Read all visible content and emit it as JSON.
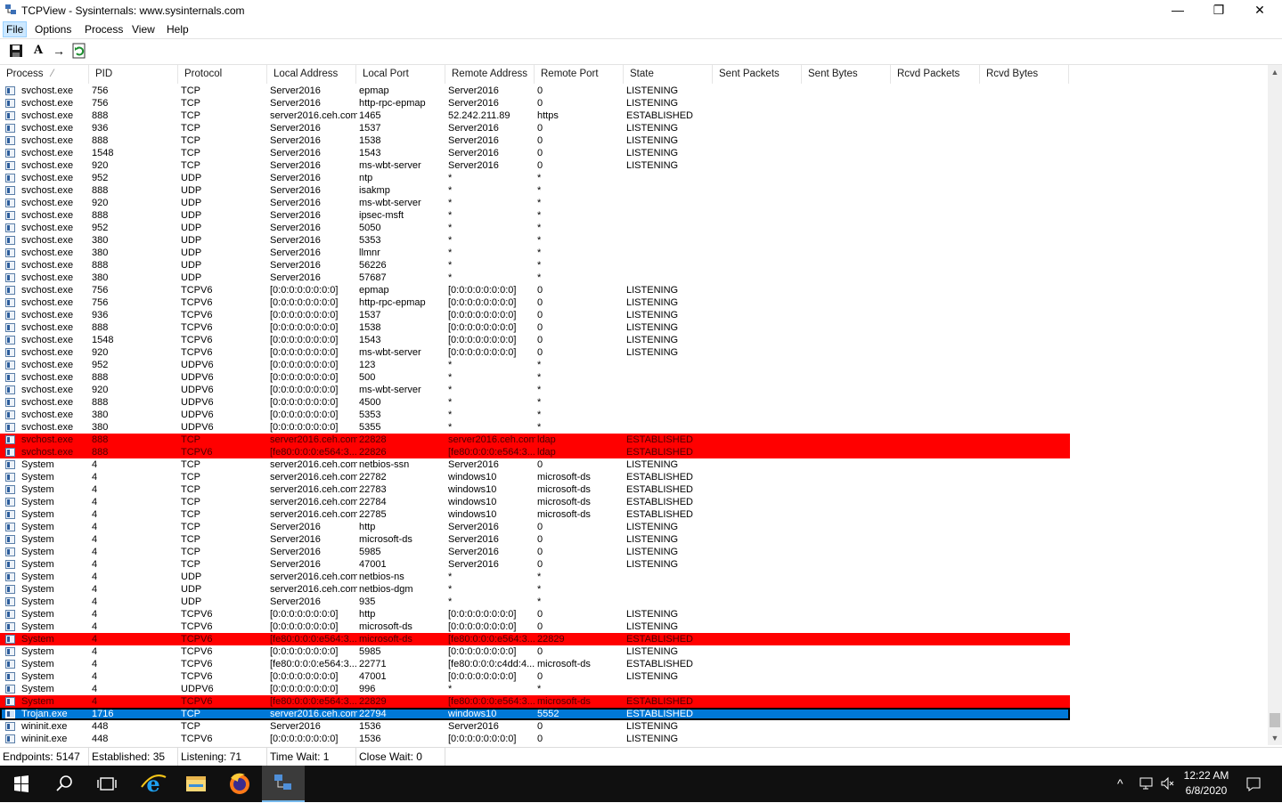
{
  "window": {
    "title": "TCPView - Sysinternals: www.sysinternals.com",
    "minimize": "—",
    "restore": "❐",
    "close": "✕"
  },
  "menu": [
    "File",
    "Options",
    "Process",
    "View",
    "Help"
  ],
  "toolbar": {
    "icons": [
      "save-icon",
      "font-icon",
      "resolve-addresses-icon",
      "refresh-icon"
    ],
    "font_glyph": "A",
    "resolve_glyph": "→"
  },
  "columns": [
    "Process",
    "PID",
    "Protocol",
    "Local Address",
    "Local Port",
    "Remote Address",
    "Remote Port",
    "State",
    "Sent Packets",
    "Sent Bytes",
    "Rcvd Packets",
    "Rcvd Bytes"
  ],
  "sort_indicator": "⁄",
  "rows": [
    [
      "svchost.exe",
      "756",
      "TCP",
      "Server2016",
      "epmap",
      "Server2016",
      "0",
      "LISTENING",
      ""
    ],
    [
      "svchost.exe",
      "756",
      "TCP",
      "Server2016",
      "http-rpc-epmap",
      "Server2016",
      "0",
      "LISTENING",
      ""
    ],
    [
      "svchost.exe",
      "888",
      "TCP",
      "server2016.ceh.com",
      "1465",
      "52.242.211.89",
      "https",
      "ESTABLISHED",
      ""
    ],
    [
      "svchost.exe",
      "936",
      "TCP",
      "Server2016",
      "1537",
      "Server2016",
      "0",
      "LISTENING",
      ""
    ],
    [
      "svchost.exe",
      "888",
      "TCP",
      "Server2016",
      "1538",
      "Server2016",
      "0",
      "LISTENING",
      ""
    ],
    [
      "svchost.exe",
      "1548",
      "TCP",
      "Server2016",
      "1543",
      "Server2016",
      "0",
      "LISTENING",
      ""
    ],
    [
      "svchost.exe",
      "920",
      "TCP",
      "Server2016",
      "ms-wbt-server",
      "Server2016",
      "0",
      "LISTENING",
      ""
    ],
    [
      "svchost.exe",
      "952",
      "UDP",
      "Server2016",
      "ntp",
      "*",
      "*",
      "",
      ""
    ],
    [
      "svchost.exe",
      "888",
      "UDP",
      "Server2016",
      "isakmp",
      "*",
      "*",
      "",
      ""
    ],
    [
      "svchost.exe",
      "920",
      "UDP",
      "Server2016",
      "ms-wbt-server",
      "*",
      "*",
      "",
      ""
    ],
    [
      "svchost.exe",
      "888",
      "UDP",
      "Server2016",
      "ipsec-msft",
      "*",
      "*",
      "",
      ""
    ],
    [
      "svchost.exe",
      "952",
      "UDP",
      "Server2016",
      "5050",
      "*",
      "*",
      "",
      ""
    ],
    [
      "svchost.exe",
      "380",
      "UDP",
      "Server2016",
      "5353",
      "*",
      "*",
      "",
      ""
    ],
    [
      "svchost.exe",
      "380",
      "UDP",
      "Server2016",
      "llmnr",
      "*",
      "*",
      "",
      ""
    ],
    [
      "svchost.exe",
      "888",
      "UDP",
      "Server2016",
      "56226",
      "*",
      "*",
      "",
      ""
    ],
    [
      "svchost.exe",
      "380",
      "UDP",
      "Server2016",
      "57687",
      "*",
      "*",
      "",
      ""
    ],
    [
      "svchost.exe",
      "756",
      "TCPV6",
      "[0:0:0:0:0:0:0:0]",
      "epmap",
      "[0:0:0:0:0:0:0:0]",
      "0",
      "LISTENING",
      ""
    ],
    [
      "svchost.exe",
      "756",
      "TCPV6",
      "[0:0:0:0:0:0:0:0]",
      "http-rpc-epmap",
      "[0:0:0:0:0:0:0:0]",
      "0",
      "LISTENING",
      ""
    ],
    [
      "svchost.exe",
      "936",
      "TCPV6",
      "[0:0:0:0:0:0:0:0]",
      "1537",
      "[0:0:0:0:0:0:0:0]",
      "0",
      "LISTENING",
      ""
    ],
    [
      "svchost.exe",
      "888",
      "TCPV6",
      "[0:0:0:0:0:0:0:0]",
      "1538",
      "[0:0:0:0:0:0:0:0]",
      "0",
      "LISTENING",
      ""
    ],
    [
      "svchost.exe",
      "1548",
      "TCPV6",
      "[0:0:0:0:0:0:0:0]",
      "1543",
      "[0:0:0:0:0:0:0:0]",
      "0",
      "LISTENING",
      ""
    ],
    [
      "svchost.exe",
      "920",
      "TCPV6",
      "[0:0:0:0:0:0:0:0]",
      "ms-wbt-server",
      "[0:0:0:0:0:0:0:0]",
      "0",
      "LISTENING",
      ""
    ],
    [
      "svchost.exe",
      "952",
      "UDPV6",
      "[0:0:0:0:0:0:0:0]",
      "123",
      "*",
      "*",
      "",
      ""
    ],
    [
      "svchost.exe",
      "888",
      "UDPV6",
      "[0:0:0:0:0:0:0:0]",
      "500",
      "*",
      "*",
      "",
      ""
    ],
    [
      "svchost.exe",
      "920",
      "UDPV6",
      "[0:0:0:0:0:0:0:0]",
      "ms-wbt-server",
      "*",
      "*",
      "",
      ""
    ],
    [
      "svchost.exe",
      "888",
      "UDPV6",
      "[0:0:0:0:0:0:0:0]",
      "4500",
      "*",
      "*",
      "",
      ""
    ],
    [
      "svchost.exe",
      "380",
      "UDPV6",
      "[0:0:0:0:0:0:0:0]",
      "5353",
      "*",
      "*",
      "",
      ""
    ],
    [
      "svchost.exe",
      "380",
      "UDPV6",
      "[0:0:0:0:0:0:0:0]",
      "5355",
      "*",
      "*",
      "",
      ""
    ],
    [
      "svchost.exe",
      "888",
      "TCP",
      "server2016.ceh.com",
      "22828",
      "server2016.ceh.com",
      "ldap",
      "ESTABLISHED",
      "red"
    ],
    [
      "svchost.exe",
      "888",
      "TCPV6",
      "[fe80:0:0:0:e564:3...",
      "22826",
      "[fe80:0:0:0:e564:3...",
      "ldap",
      "ESTABLISHED",
      "red"
    ],
    [
      "System",
      "4",
      "TCP",
      "server2016.ceh.com",
      "netbios-ssn",
      "Server2016",
      "0",
      "LISTENING",
      ""
    ],
    [
      "System",
      "4",
      "TCP",
      "server2016.ceh.com",
      "22782",
      "windows10",
      "microsoft-ds",
      "ESTABLISHED",
      ""
    ],
    [
      "System",
      "4",
      "TCP",
      "server2016.ceh.com",
      "22783",
      "windows10",
      "microsoft-ds",
      "ESTABLISHED",
      ""
    ],
    [
      "System",
      "4",
      "TCP",
      "server2016.ceh.com",
      "22784",
      "windows10",
      "microsoft-ds",
      "ESTABLISHED",
      ""
    ],
    [
      "System",
      "4",
      "TCP",
      "server2016.ceh.com",
      "22785",
      "windows10",
      "microsoft-ds",
      "ESTABLISHED",
      ""
    ],
    [
      "System",
      "4",
      "TCP",
      "Server2016",
      "http",
      "Server2016",
      "0",
      "LISTENING",
      ""
    ],
    [
      "System",
      "4",
      "TCP",
      "Server2016",
      "microsoft-ds",
      "Server2016",
      "0",
      "LISTENING",
      ""
    ],
    [
      "System",
      "4",
      "TCP",
      "Server2016",
      "5985",
      "Server2016",
      "0",
      "LISTENING",
      ""
    ],
    [
      "System",
      "4",
      "TCP",
      "Server2016",
      "47001",
      "Server2016",
      "0",
      "LISTENING",
      ""
    ],
    [
      "System",
      "4",
      "UDP",
      "server2016.ceh.com",
      "netbios-ns",
      "*",
      "*",
      "",
      ""
    ],
    [
      "System",
      "4",
      "UDP",
      "server2016.ceh.com",
      "netbios-dgm",
      "*",
      "*",
      "",
      ""
    ],
    [
      "System",
      "4",
      "UDP",
      "Server2016",
      "935",
      "*",
      "*",
      "",
      ""
    ],
    [
      "System",
      "4",
      "TCPV6",
      "[0:0:0:0:0:0:0:0]",
      "http",
      "[0:0:0:0:0:0:0:0]",
      "0",
      "LISTENING",
      ""
    ],
    [
      "System",
      "4",
      "TCPV6",
      "[0:0:0:0:0:0:0:0]",
      "microsoft-ds",
      "[0:0:0:0:0:0:0:0]",
      "0",
      "LISTENING",
      ""
    ],
    [
      "System",
      "4",
      "TCPV6",
      "[fe80:0:0:0:e564:3...",
      "microsoft-ds",
      "[fe80:0:0:0:e564:3...",
      "22829",
      "ESTABLISHED",
      "red"
    ],
    [
      "System",
      "4",
      "TCPV6",
      "[0:0:0:0:0:0:0:0]",
      "5985",
      "[0:0:0:0:0:0:0:0]",
      "0",
      "LISTENING",
      ""
    ],
    [
      "System",
      "4",
      "TCPV6",
      "[fe80:0:0:0:e564:3...",
      "22771",
      "[fe80:0:0:0:c4dd:4...",
      "microsoft-ds",
      "ESTABLISHED",
      ""
    ],
    [
      "System",
      "4",
      "TCPV6",
      "[0:0:0:0:0:0:0:0]",
      "47001",
      "[0:0:0:0:0:0:0:0]",
      "0",
      "LISTENING",
      ""
    ],
    [
      "System",
      "4",
      "UDPV6",
      "[0:0:0:0:0:0:0:0]",
      "996",
      "*",
      "*",
      "",
      ""
    ],
    [
      "System",
      "4",
      "TCPV6",
      "[fe80:0:0:0:e564:3...",
      "22829",
      "[fe80:0:0:0:e564:3...",
      "microsoft-ds",
      "ESTABLISHED",
      "red"
    ],
    [
      "Trojan.exe",
      "1716",
      "TCP",
      "server2016.ceh.com",
      "22794",
      "windows10",
      "5552",
      "ESTABLISHED",
      "sel"
    ],
    [
      "wininit.exe",
      "448",
      "TCP",
      "Server2016",
      "1536",
      "Server2016",
      "0",
      "LISTENING",
      ""
    ],
    [
      "wininit.exe",
      "448",
      "TCPV6",
      "[0:0:0:0:0:0:0:0]",
      "1536",
      "[0:0:0:0:0:0:0:0]",
      "0",
      "LISTENING",
      ""
    ]
  ],
  "status": {
    "endpoints": "Endpoints: 5147",
    "established": "Established: 35",
    "listening": "Listening: 71",
    "time_wait": "Time Wait: 1",
    "close_wait": "Close Wait: 0"
  },
  "scrollbar": {
    "up": "▲",
    "down": "▼"
  },
  "taskbar": {
    "apps": [
      "start-icon",
      "search-icon",
      "task-view-icon",
      "internet-explorer-icon",
      "file-explorer-icon",
      "firefox-icon",
      "tcpview-icon"
    ],
    "tray_chevron": "^",
    "time": "12:22 AM",
    "date": "6/8/2020"
  },
  "colors": {
    "red_highlight": "#ff0000",
    "selection": "#0078d7",
    "taskbar": "#101010"
  }
}
